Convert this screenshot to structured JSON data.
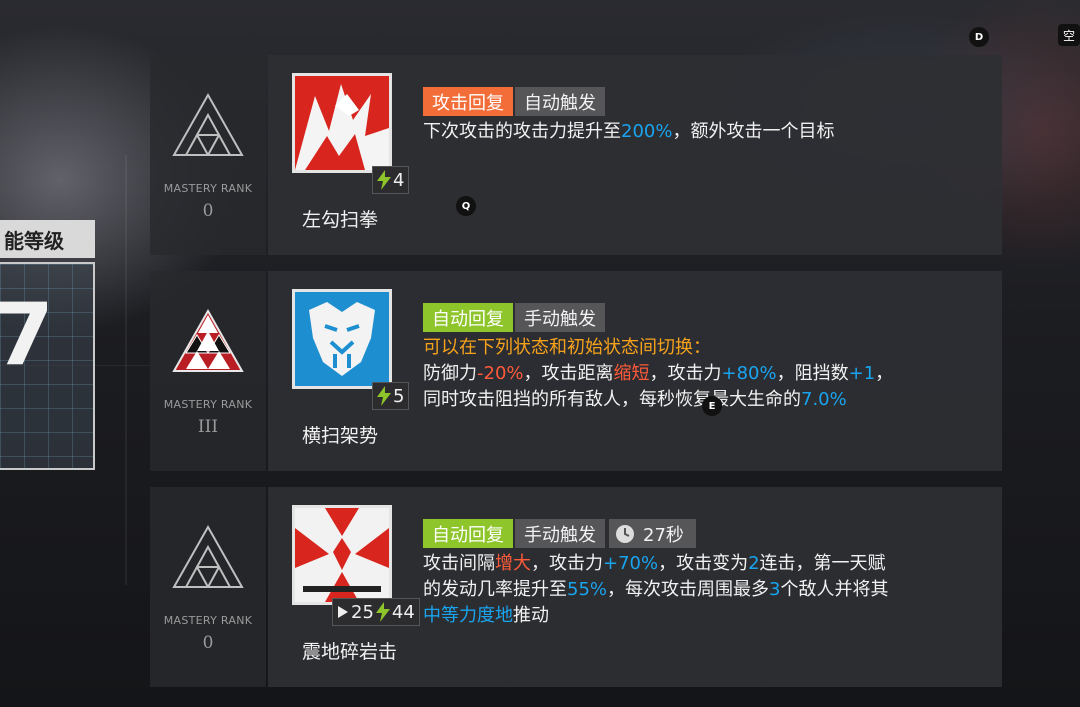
{
  "level_panel": {
    "title": "能等级",
    "level": "7"
  },
  "hotkeys": {
    "d": "D",
    "q": "Q",
    "e": "E",
    "corner": "空"
  },
  "skills": [
    {
      "name": "左勾扫拳",
      "rank_label": "MASTERY RANK",
      "rank_value": "0",
      "sp": "4",
      "tags": [
        "攻击回复",
        "自动触发"
      ],
      "desc": {
        "p1": "下次攻击的攻击力提升至",
        "v1": "200%",
        "p2": "，额外攻击一个目标"
      }
    },
    {
      "name": "横扫架势",
      "rank_label": "MASTERY RANK",
      "rank_value": "III",
      "sp": "5",
      "tags": [
        "自动回复",
        "手动触发"
      ],
      "desc": {
        "headline": "可以在下列状态和初始状态间切换：",
        "a": "防御力",
        "b": "-20%",
        "c": "，攻击距离",
        "d": "缩短",
        "e": "，攻击力",
        "f": "+80%",
        "g": "，阻挡数",
        "h": "+1",
        "i": "，",
        "j": "同时攻击阻挡的所有敌人，每秒恢复最大生命的",
        "k": "7.0%"
      }
    },
    {
      "name": "震地碎岩击",
      "rank_label": "MASTERY RANK",
      "rank_value": "0",
      "init_sp": "25",
      "sp": "44",
      "duration": "27秒",
      "tags": [
        "自动回复",
        "手动触发"
      ],
      "desc": {
        "a": "攻击间隔",
        "b": "增大",
        "c": "，攻击力",
        "d": "+70%",
        "e": "，攻击变为",
        "f": "2",
        "g": "连击，第一天赋",
        "h": "的发动几率提升至",
        "i": "55%",
        "j": "，每次攻击周围最多",
        "k": "3",
        "l": "个敌人并将其",
        "m": "中等力度地",
        "n": "推动"
      }
    }
  ],
  "colors": {
    "tag_orange": "#f26d38",
    "tag_green": "#8ec52b",
    "value_blue": "#19a4ef",
    "value_red": "#ff5a3a",
    "headline_orange": "#f6a21b"
  },
  "icons": [
    "lightning-icon",
    "play-icon",
    "clock-icon",
    "mastery-triangle-icon"
  ]
}
